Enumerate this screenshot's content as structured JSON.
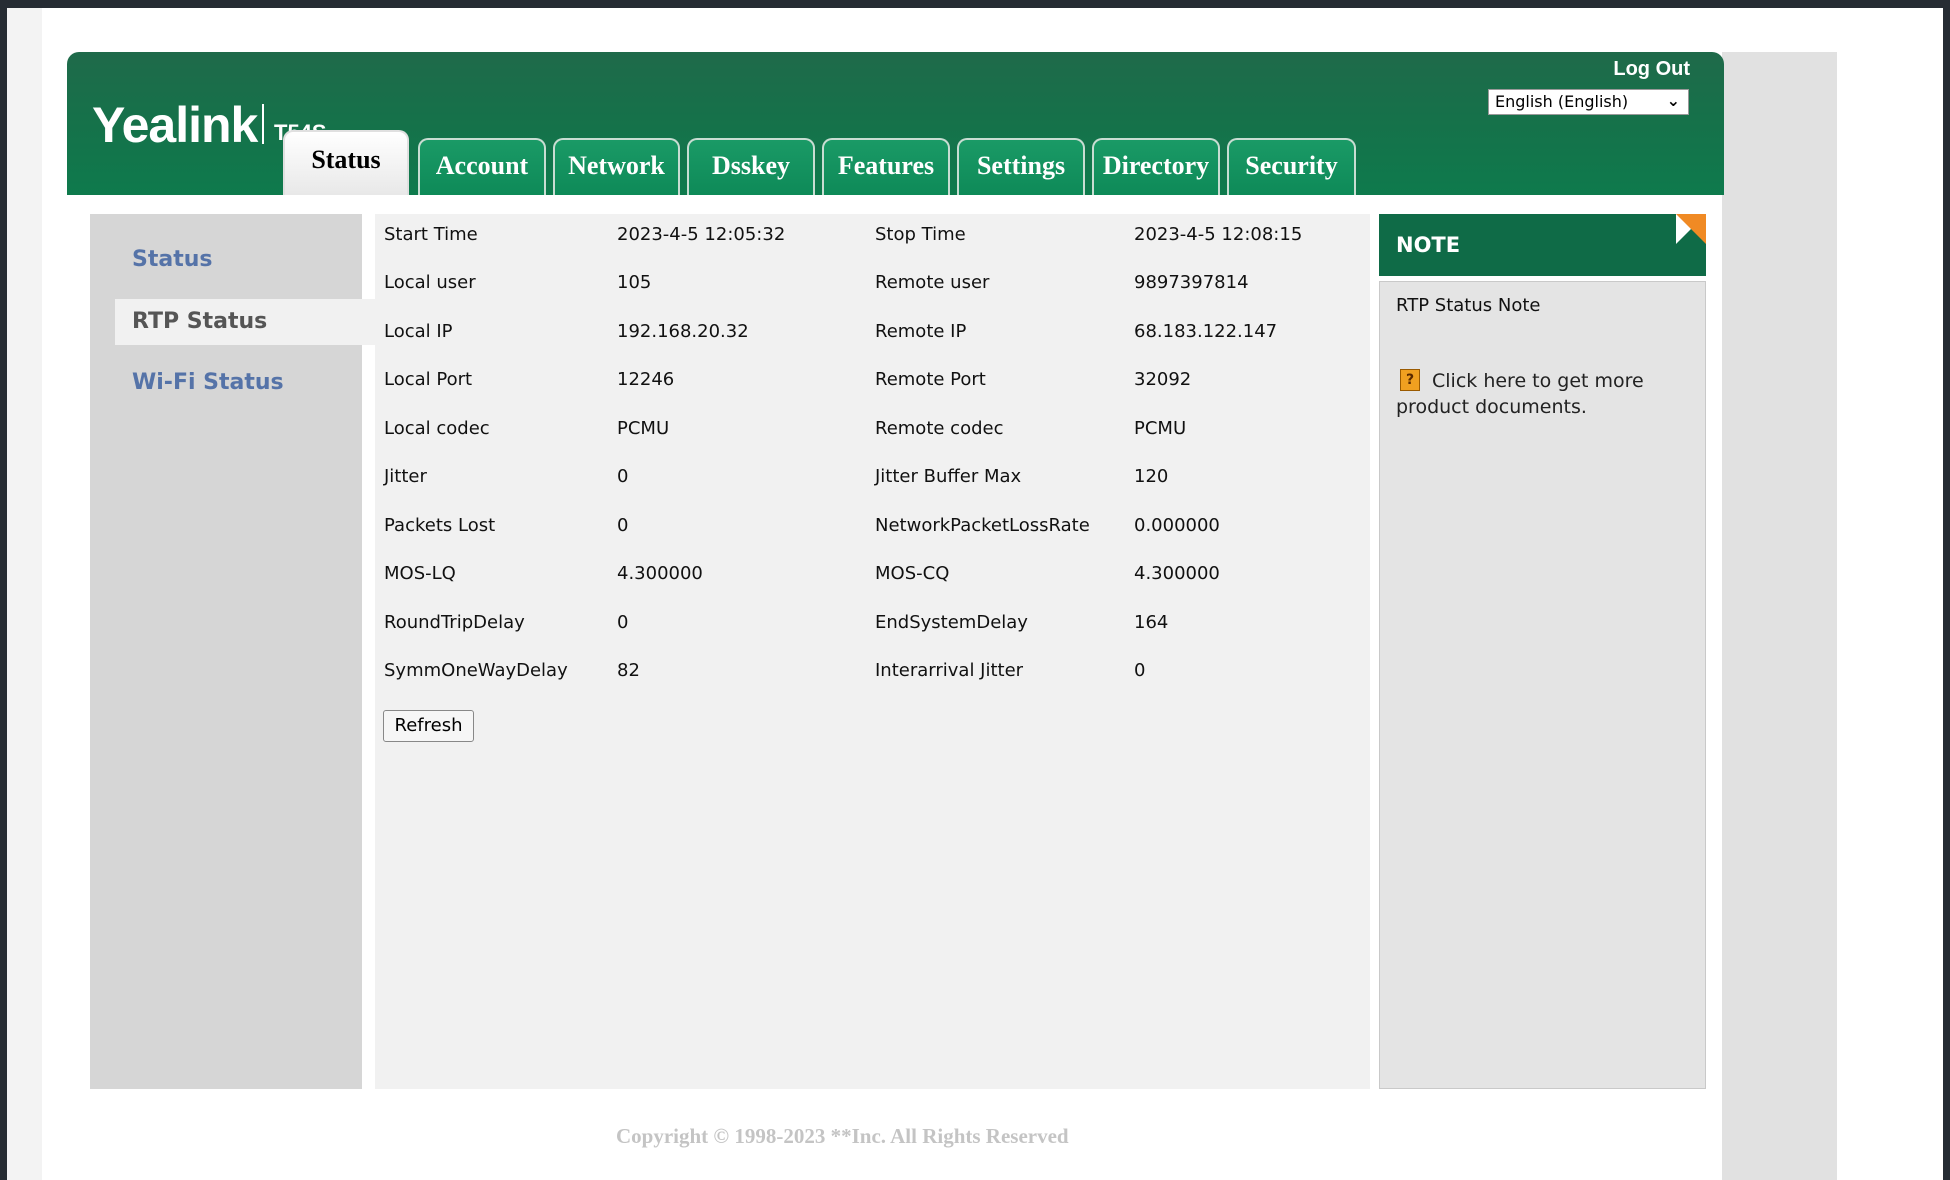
{
  "header": {
    "brand": "Yealink",
    "model": "T54S",
    "logout_label": "Log Out",
    "language": "English (English)"
  },
  "tabs": [
    {
      "label": "Status",
      "active": true
    },
    {
      "label": "Account"
    },
    {
      "label": "Network"
    },
    {
      "label": "Dsskey"
    },
    {
      "label": "Features"
    },
    {
      "label": "Settings"
    },
    {
      "label": "Directory"
    },
    {
      "label": "Security"
    }
  ],
  "sidebar": {
    "items": [
      {
        "label": "Status"
      },
      {
        "label": "RTP Status",
        "active": true
      },
      {
        "label": "Wi-Fi Status"
      }
    ]
  },
  "rtp": {
    "rows": [
      {
        "k1": "Start Time",
        "v1": "2023-4-5 12:05:32",
        "k2": "Stop Time",
        "v2": "2023-4-5 12:08:15"
      },
      {
        "k1": "Local user",
        "v1": "105",
        "k2": "Remote user",
        "v2": "9897397814"
      },
      {
        "k1": "Local IP",
        "v1": "192.168.20.32",
        "k2": "Remote IP",
        "v2": "68.183.122.147"
      },
      {
        "k1": "Local Port",
        "v1": "12246",
        "k2": "Remote Port",
        "v2": "32092"
      },
      {
        "k1": "Local codec",
        "v1": "PCMU",
        "k2": "Remote codec",
        "v2": "PCMU"
      },
      {
        "k1": "Jitter",
        "v1": "0",
        "k2": "Jitter Buffer Max",
        "v2": "120"
      },
      {
        "k1": "Packets Lost",
        "v1": "0",
        "k2": "NetworkPacketLossRate",
        "v2": "0.000000"
      },
      {
        "k1": "MOS-LQ",
        "v1": "4.300000",
        "k2": "MOS-CQ",
        "v2": "4.300000"
      },
      {
        "k1": "RoundTripDelay",
        "v1": "0",
        "k2": "EndSystemDelay",
        "v2": "164"
      },
      {
        "k1": "SymmOneWayDelay",
        "v1": "82",
        "k2": "Interarrival Jitter",
        "v2": "0"
      }
    ],
    "refresh_label": "Refresh"
  },
  "note": {
    "heading": "NOTE",
    "title": "RTP Status Note",
    "link_text": "Click here to get more product documents.",
    "icon_glyph": "?"
  },
  "footer": {
    "copyright": "Copyright © 1998-2023 **Inc. All Rights Reserved"
  }
}
